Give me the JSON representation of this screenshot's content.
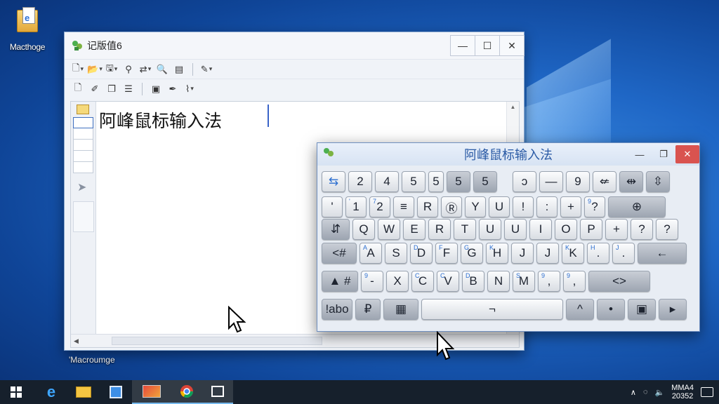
{
  "desktop": {
    "icon_label": "Macthoge",
    "bottom_label": "'Macroumge"
  },
  "notepad": {
    "title": "记版值6",
    "minimize": "—",
    "maximize": "☐",
    "close": "✕",
    "content": "阿峰鼠标输入法"
  },
  "keyboard": {
    "title": "阿峰鼠标输入法",
    "minimize": "—",
    "maximize": "❐",
    "close": "✕",
    "rows": [
      [
        {
          "l": "⇆",
          "w": 34,
          "cls": "blue-ic"
        },
        {
          "l": "2",
          "w": 34
        },
        {
          "l": "4",
          "w": 34
        },
        {
          "l": "5",
          "w": 34
        },
        {
          "l": "5",
          "w": 22
        },
        {
          "l": "5",
          "w": 34,
          "cls": "dark"
        },
        {
          "l": "5",
          "w": 34,
          "cls": "dark"
        },
        {
          "l": "",
          "w": 14
        },
        {
          "l": "ↄ",
          "w": 34
        },
        {
          "l": "—",
          "w": 34
        },
        {
          "l": "9",
          "w": 34
        },
        {
          "l": "⇍",
          "w": 34
        },
        {
          "l": "⇹",
          "w": 34,
          "cls": "dark"
        },
        {
          "l": "⇳",
          "w": 34,
          "cls": "dark"
        }
      ],
      [
        {
          "l": "'",
          "w": 30
        },
        {
          "l": "1",
          "w": 30,
          "s": "'"
        },
        {
          "l": "2",
          "w": 30,
          "s": "7"
        },
        {
          "l": "≡",
          "w": 30
        },
        {
          "l": "R",
          "w": 30
        },
        {
          "l": "Ⓡ",
          "w": 30
        },
        {
          "l": "Y",
          "w": 30
        },
        {
          "l": "U",
          "w": 30
        },
        {
          "l": "!",
          "w": 30
        },
        {
          "l": ":",
          "w": 30
        },
        {
          "l": "+",
          "w": 30
        },
        {
          "l": "?",
          "w": 30,
          "s": "9"
        },
        {
          "l": "⊕",
          "w": 82,
          "cls": "dark"
        }
      ],
      [
        {
          "l": "⇵",
          "w": 40,
          "cls": "dark"
        },
        {
          "l": "Q",
          "w": 32
        },
        {
          "l": "W",
          "w": 32
        },
        {
          "l": "E",
          "w": 32
        },
        {
          "l": "R",
          "w": 32
        },
        {
          "l": "T",
          "w": 32
        },
        {
          "l": "U",
          "w": 32
        },
        {
          "l": "U",
          "w": 32
        },
        {
          "l": "I",
          "w": 32
        },
        {
          "l": "O",
          "w": 32
        },
        {
          "l": "P",
          "w": 32
        },
        {
          "l": "+",
          "w": 32
        },
        {
          "l": "?",
          "w": 32
        },
        {
          "l": "?",
          "w": 32
        }
      ],
      [
        {
          "l": "<#",
          "w": 50,
          "cls": "dark"
        },
        {
          "l": "A",
          "w": 32,
          "s": "A"
        },
        {
          "l": "S",
          "w": 32
        },
        {
          "l": "D",
          "w": 32,
          "s": "D"
        },
        {
          "l": "F",
          "w": 32,
          "s": "F"
        },
        {
          "l": "G",
          "w": 32,
          "s": "G"
        },
        {
          "l": "H",
          "w": 32,
          "s": "K"
        },
        {
          "l": "J",
          "w": 32
        },
        {
          "l": "J",
          "w": 32
        },
        {
          "l": "K",
          "w": 32,
          "s": "K"
        },
        {
          "l": ".",
          "w": 32,
          "s": "H"
        },
        {
          "l": ".",
          "w": 32,
          "s": "J"
        },
        {
          "l": "←",
          "w": 70,
          "cls": "dark"
        }
      ],
      [
        {
          "l": "▲ #",
          "w": 52,
          "cls": "dark"
        },
        {
          "l": "-",
          "w": 32,
          "s": "9"
        },
        {
          "l": "X",
          "w": 32
        },
        {
          "l": "C",
          "w": 32,
          "s": "C"
        },
        {
          "l": "V",
          "w": 32,
          "s": "C"
        },
        {
          "l": "B",
          "w": 32,
          "s": "D"
        },
        {
          "l": "N",
          "w": 32
        },
        {
          "l": "M",
          "w": 32,
          "s": "S"
        },
        {
          "l": ",",
          "w": 32,
          "s": "9"
        },
        {
          "l": ",",
          "w": 32,
          "s": "9"
        },
        {
          "l": "<>",
          "w": 88,
          "cls": "dark"
        }
      ],
      [
        {
          "l": "!abo",
          "w": 44,
          "cls": "dark"
        },
        {
          "l": "₽",
          "w": 36,
          "cls": "dark"
        },
        {
          "l": "▦",
          "w": 50,
          "cls": "dark"
        },
        {
          "l": "¬",
          "w": 202
        },
        {
          "l": "^",
          "w": 40,
          "cls": "dark"
        },
        {
          "l": "•",
          "w": 40,
          "cls": "dark"
        },
        {
          "l": "▣",
          "w": 40,
          "cls": "dark"
        },
        {
          "l": "▸",
          "w": 40,
          "cls": "dark"
        }
      ]
    ]
  },
  "taskbar": {
    "clock_time": "MMA4",
    "clock_date": "20352",
    "apps": [
      "start",
      "edge-icon",
      "file-explorer-icon",
      "store-icon",
      "photos-icon",
      "chrome-icon",
      "app-icon"
    ]
  }
}
